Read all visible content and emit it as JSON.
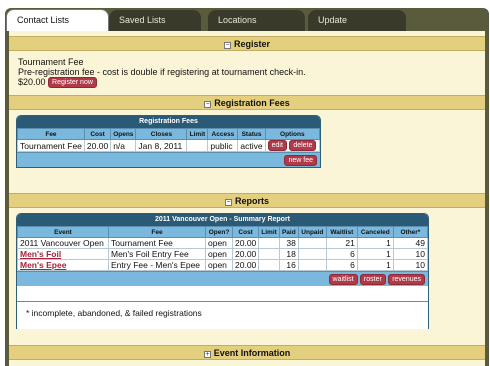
{
  "tabs": [
    {
      "label": "Contact Lists",
      "active": true
    },
    {
      "label": "Saved Lists",
      "active": false
    },
    {
      "label": "Locations",
      "active": false
    },
    {
      "label": "Update",
      "active": false
    }
  ],
  "sections": {
    "register": "Register",
    "reg_fees": "Registration Fees",
    "reports": "Reports",
    "event_info": "Event Information"
  },
  "register": {
    "line1": "Tournament Fee",
    "line2": "Pre-registration fee - cost is double if registering at tournament check-in.",
    "price": "$20.00",
    "button": "Register now"
  },
  "fees_table": {
    "title": "Registration Fees",
    "columns": [
      "Fee",
      "Cost",
      "Opens",
      "Closes",
      "Limit",
      "Access",
      "Status",
      "Options"
    ],
    "row": {
      "fee": "Tournament Fee",
      "cost": "20.00",
      "opens": "n/a",
      "closes": "Jan 8, 2011",
      "limit": "",
      "access": "public",
      "status": "active"
    },
    "edit": "edit",
    "delete": "delete",
    "new_fee": "new fee"
  },
  "report_table": {
    "title": "2011 Vancouver Open - Summary Report",
    "columns": [
      "Event",
      "Fee",
      "Open?",
      "Cost",
      "Limit",
      "Paid",
      "Unpaid",
      "Waitlist",
      "Canceled",
      "Other*"
    ],
    "rows": [
      {
        "event": "2011 Vancouver Open",
        "fee": "Tournament Fee",
        "open": "open",
        "cost": "20.00",
        "limit": "",
        "paid": "38",
        "unpaid": "",
        "waitlist": "21",
        "canceled": "1",
        "other": "49"
      },
      {
        "event": "Men's Foil",
        "fee": "Men's Foil Entry Fee",
        "open": "open",
        "cost": "20.00",
        "limit": "",
        "paid": "18",
        "unpaid": "",
        "waitlist": "6",
        "canceled": "1",
        "other": "10"
      },
      {
        "event": "Men's Epee",
        "fee": "Entry Fee - Men's Epee",
        "open": "open",
        "cost": "20.00",
        "limit": "",
        "paid": "16",
        "unpaid": "",
        "waitlist": "6",
        "canceled": "1",
        "other": "10"
      }
    ],
    "buttons": {
      "waitlist": "waitlist",
      "roster": "roster",
      "revenues": "revenues"
    },
    "footnote": "* incomplete, abandoned, & failed registrations"
  },
  "colors": {
    "accent": "#b03a4a",
    "header_band": "#e4cf7e",
    "table_head": "#7ab8de",
    "box_title": "#2a5a76",
    "tab_bar": "#5a5a3c"
  }
}
